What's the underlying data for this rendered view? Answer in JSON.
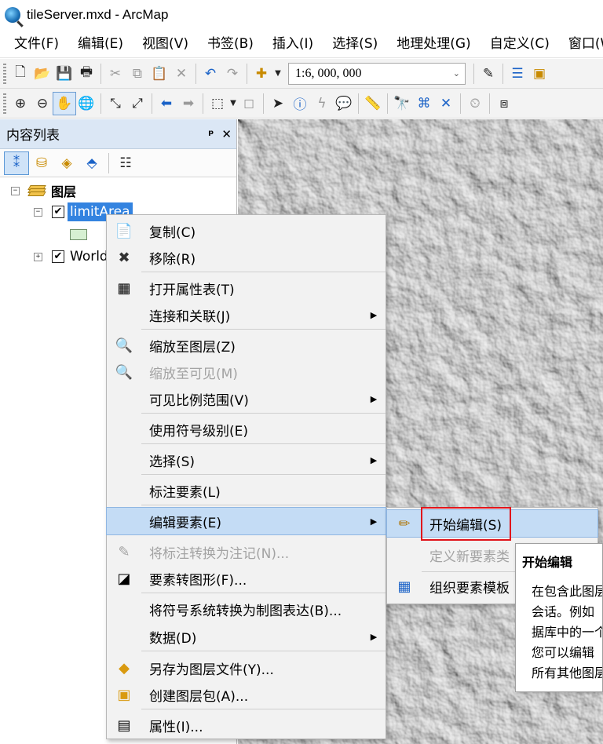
{
  "window": {
    "title": "tileServer.mxd - ArcMap"
  },
  "menubar": [
    "文件(F)",
    "编辑(E)",
    "视图(V)",
    "书签(B)",
    "插入(I)",
    "选择(S)",
    "地理处理(G)",
    "自定义(C)",
    "窗口(W)"
  ],
  "toolbar": {
    "scale": "1:6, 000, 000"
  },
  "toc": {
    "title": "内容列表",
    "pin": "ᵖ",
    "close": "✕",
    "root": "图层",
    "layers": [
      {
        "name": "limitArea",
        "checked": "✔",
        "expander": "−"
      },
      {
        "name": "World",
        "checked": "✔",
        "expander": "+"
      }
    ]
  },
  "context_menu": {
    "items": [
      {
        "label": "复制(C)",
        "icon": "copy-icon",
        "glyph": "📄",
        "disabled": false,
        "submenu": false
      },
      {
        "label": "移除(R)",
        "icon": "remove-icon",
        "glyph": "✖",
        "disabled": false,
        "submenu": false
      },
      {
        "label": "打开属性表(T)",
        "icon": "table-icon",
        "glyph": "▦",
        "disabled": false,
        "submenu": false
      },
      {
        "label": "连接和关联(J)",
        "icon": "",
        "glyph": "",
        "disabled": false,
        "submenu": true
      },
      {
        "label": "缩放至图层(Z)",
        "icon": "zoom-layer-icon",
        "glyph": "🔍",
        "disabled": false,
        "submenu": false
      },
      {
        "label": "缩放至可见(M)",
        "icon": "zoom-visible-icon",
        "glyph": "🔍",
        "disabled": true,
        "submenu": false
      },
      {
        "label": "可见比例范围(V)",
        "icon": "",
        "glyph": "",
        "disabled": false,
        "submenu": true
      },
      {
        "label": "使用符号级别(E)",
        "icon": "",
        "glyph": "",
        "disabled": false,
        "submenu": false
      },
      {
        "label": "选择(S)",
        "icon": "",
        "glyph": "",
        "disabled": false,
        "submenu": true
      },
      {
        "label": "标注要素(L)",
        "icon": "",
        "glyph": "",
        "disabled": false,
        "submenu": false
      },
      {
        "label": "编辑要素(E)",
        "icon": "",
        "glyph": "",
        "disabled": false,
        "submenu": true,
        "highlighted": true
      },
      {
        "label": "将标注转换为注记(N)...",
        "icon": "convert-labels-icon",
        "glyph": "✎",
        "disabled": true,
        "submenu": false
      },
      {
        "label": "要素转图形(F)...",
        "icon": "features-to-graphics-icon",
        "glyph": "◪",
        "disabled": false,
        "submenu": false
      },
      {
        "label": "将符号系统转换为制图表达(B)...",
        "icon": "",
        "glyph": "",
        "disabled": false,
        "submenu": false
      },
      {
        "label": "数据(D)",
        "icon": "",
        "glyph": "",
        "disabled": false,
        "submenu": true
      },
      {
        "label": "另存为图层文件(Y)...",
        "icon": "layer-file-icon",
        "glyph": "◆",
        "disabled": false,
        "submenu": false
      },
      {
        "label": "创建图层包(A)...",
        "icon": "layer-package-icon",
        "glyph": "▣",
        "disabled": false,
        "submenu": false
      },
      {
        "label": "属性(I)...",
        "icon": "properties-icon",
        "glyph": "▤",
        "disabled": false,
        "submenu": false
      }
    ],
    "submenu_arrow": "▶"
  },
  "submenu": {
    "items": [
      {
        "label": "开始编辑(S)",
        "icon": "pencil-icon",
        "glyph": "✏",
        "disabled": false
      },
      {
        "label": "定义新要素类",
        "icon": "",
        "glyph": "",
        "disabled": true
      },
      {
        "label": "组织要素模板",
        "icon": "feature-templates-icon",
        "glyph": "▦",
        "disabled": false
      }
    ]
  },
  "tooltip": {
    "title": "开始编辑",
    "lines": [
      "在包含此图层",
      "会话。例如",
      "据库中的一个",
      "您可以编辑",
      "所有其他图层"
    ]
  },
  "colors": {
    "selection": "#3383e0",
    "menu_highlight": "#c4dcf5",
    "callout": "#e0141b",
    "toc_header": "#dbe7f5"
  }
}
